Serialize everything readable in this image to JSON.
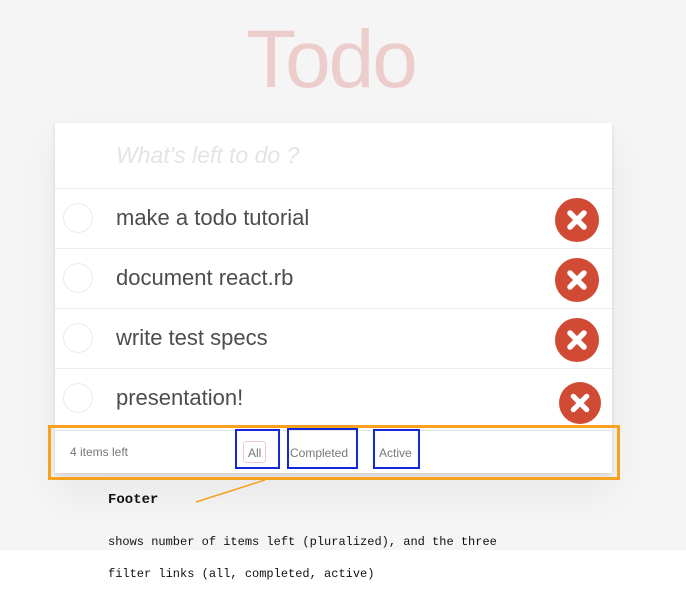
{
  "app": {
    "title": "Todo"
  },
  "new_todo": {
    "placeholder": "What's left to do ?"
  },
  "todos": [
    {
      "label": "make a todo tutorial",
      "completed": false
    },
    {
      "label": "document react.rb",
      "completed": false
    },
    {
      "label": "write test specs",
      "completed": false
    },
    {
      "label": "presentation!",
      "completed": false
    }
  ],
  "footer": {
    "count_text": "4 items left",
    "filters": [
      {
        "label": "All",
        "selected": true
      },
      {
        "label": "Completed",
        "selected": false
      },
      {
        "label": "Active",
        "selected": false
      }
    ]
  },
  "annotation": {
    "title": "Footer",
    "lines": [
      "shows number of items left (pluralized), and the three",
      "filter links (all, completed, active)"
    ]
  },
  "colors": {
    "destroy_button": "#d04a34",
    "highlight_box": "#1426d9",
    "footer_outline": "#f7a11e"
  },
  "icons": {
    "destroy": "close-circle-icon",
    "toggle": "circle-checkbox"
  }
}
